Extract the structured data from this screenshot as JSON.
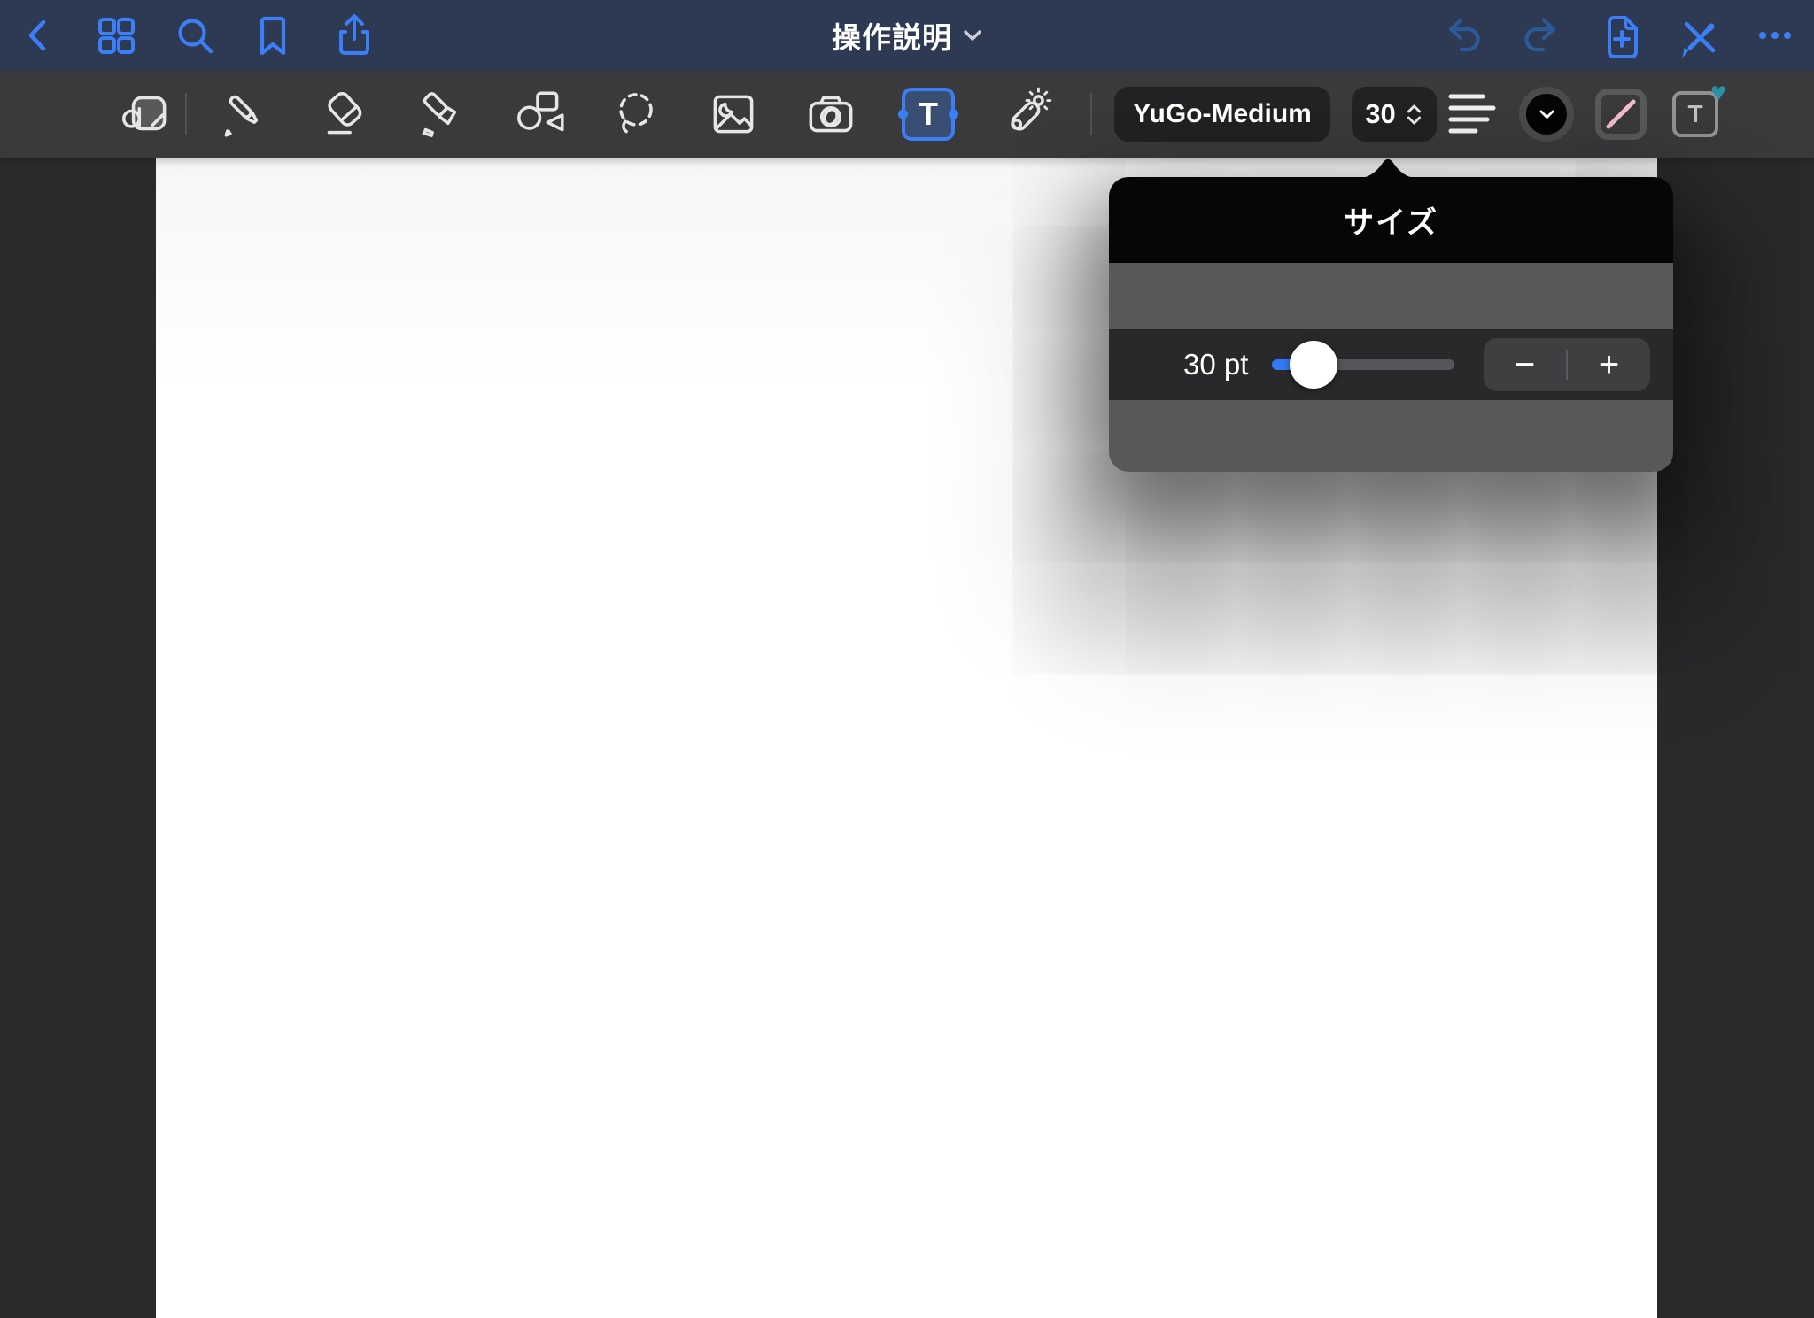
{
  "navbar": {
    "title": "操作説明",
    "left_icons": [
      "back",
      "grid-view",
      "search",
      "bookmark",
      "share"
    ],
    "right_icons": [
      "undo",
      "redo",
      "add-page",
      "stylus-and-pen",
      "more"
    ]
  },
  "toolbar": {
    "tools": [
      "view-mode",
      "pen",
      "eraser",
      "highlighter",
      "shapes",
      "lasso",
      "image",
      "camera",
      "text",
      "laser-pointer"
    ],
    "selected_tool": "text",
    "glyph_T": "T",
    "heart_glyph": "♥",
    "font_name": "YuGo-Medium",
    "font_size": "30"
  },
  "popover": {
    "title": "サイズ",
    "size_label": "30 pt",
    "minus_label": "−",
    "plus_label": "+",
    "slider": {
      "value_pt": 30,
      "percent": 23
    }
  },
  "colors": {
    "accent_blue": "#3c7ef6",
    "accent_blue_dim": "#2c5998",
    "navbar_bg": "#2e3a53",
    "toolbar_bg": "#3a3a3c",
    "button_bg": "#222224",
    "canvas_bg": "#2a2a2c",
    "popover_black": "#060606",
    "popover_gray": "#58585a",
    "popover_dark": "#29292b",
    "slider_blue": "#3478f6",
    "icon_light": "#e6e6e8",
    "stroke_pink": "#f2bcc9",
    "heart_teal": "#2b8fa6"
  }
}
